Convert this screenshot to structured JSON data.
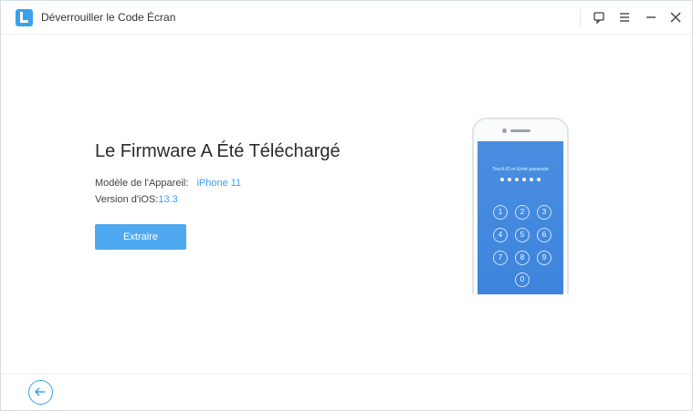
{
  "app": {
    "title": "Déverrouiller le Code Écran"
  },
  "titlebar": {
    "icons": [
      "feedback-icon",
      "menu-icon",
      "minimize-icon",
      "close-icon"
    ]
  },
  "main": {
    "heading": "Le Firmware A Été Téléchargé",
    "model_label": "Modèle de l'Appareil:",
    "model_value": "iPhone 11",
    "ios_label": "Version d'iOS:",
    "ios_value": "13.3",
    "extract_button": "Extraire"
  },
  "phone": {
    "prompt": "Touch ID or Enter passcode",
    "passcode_dots": 6,
    "keys": [
      "1",
      "2",
      "3",
      "4",
      "5",
      "6",
      "7",
      "8",
      "9",
      "0"
    ]
  },
  "footer": {
    "back_icon": "arrow-left-icon"
  },
  "colors": {
    "accent": "#3aa0ec",
    "button": "#4fa9f0",
    "screen": "#4a8ee0"
  }
}
